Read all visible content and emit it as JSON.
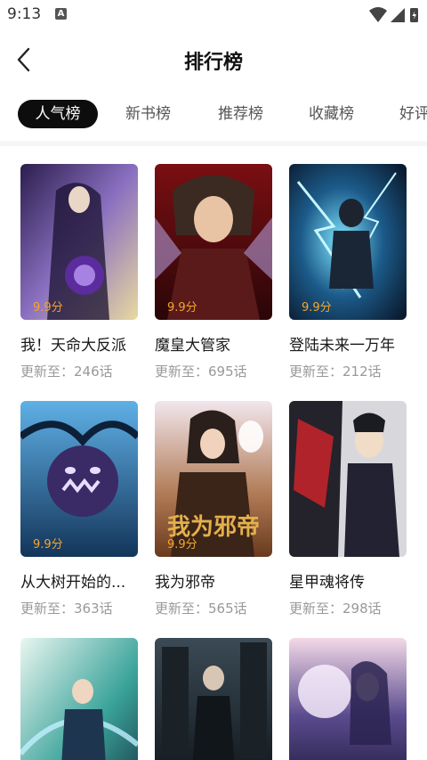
{
  "status": {
    "time": "9:13",
    "notif": "A"
  },
  "header": {
    "title": "排行榜"
  },
  "tabs": [
    {
      "label": "人气榜",
      "active": true
    },
    {
      "label": "新书榜",
      "active": false
    },
    {
      "label": "推荐榜",
      "active": false
    },
    {
      "label": "收藏榜",
      "active": false
    },
    {
      "label": "好评",
      "active": false
    }
  ],
  "comics": [
    {
      "title": "我！天命大反派",
      "update": "更新至：246话",
      "score": "9.9分"
    },
    {
      "title": "魔皇大管家",
      "update": "更新至：695话",
      "score": "9.9分"
    },
    {
      "title": "登陆未来一万年",
      "update": "更新至：212话",
      "score": "9.9分"
    },
    {
      "title": "从大树开始的...",
      "update": "更新至：363话",
      "score": "9.9分"
    },
    {
      "title": "我为邪帝",
      "update": "更新至：565话",
      "score": "9.9分"
    },
    {
      "title": "星甲魂将传",
      "update": "更新至：298话",
      "score": ""
    },
    {
      "title": "",
      "update": "",
      "score": ""
    },
    {
      "title": "",
      "update": "",
      "score": ""
    },
    {
      "title": "",
      "update": "",
      "score": ""
    }
  ],
  "colors": {
    "tab_active_bg": "#0d0d0d",
    "score": "#f4a52e",
    "meta": "#999999"
  }
}
